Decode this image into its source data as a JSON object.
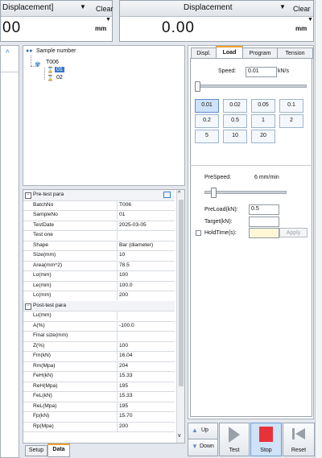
{
  "displays": [
    {
      "title": "Displacement]",
      "clear": "Clear",
      "value": "00",
      "unit": "mm"
    },
    {
      "title": "Displacement",
      "clear": "Clear",
      "value": "0.00",
      "unit": "mm"
    }
  ],
  "tree": {
    "root_label": "Sample number",
    "batch": "T006",
    "items": [
      "01",
      "02"
    ]
  },
  "pretest": {
    "title": "Pre-test para",
    "rows": [
      {
        "k": "BatchNo",
        "v": "T006"
      },
      {
        "k": "SampleNo",
        "v": "01"
      },
      {
        "k": "TestDate",
        "v": "2025-03-05"
      },
      {
        "k": "Test one",
        "v": ""
      },
      {
        "k": "Shape",
        "v": "Bar (diameter)"
      },
      {
        "k": "Size(mm)",
        "v": "10"
      },
      {
        "k": "Area(mm^2)",
        "v": "78.5"
      },
      {
        "k": "Lo(mm)",
        "v": "100"
      },
      {
        "k": "Le(mm)",
        "v": "100.0"
      },
      {
        "k": "Lc(mm)",
        "v": "200"
      }
    ]
  },
  "posttest": {
    "title": "Post-test para",
    "rows": [
      {
        "k": "Lu(mm)",
        "v": ""
      },
      {
        "k": "A(%)",
        "v": "-100.0"
      },
      {
        "k": "Final size(mm)",
        "v": ""
      },
      {
        "k": "Z(%)",
        "v": "100"
      },
      {
        "k": "Fm(kN)",
        "v": "16.04"
      },
      {
        "k": "Rm(Mpa)",
        "v": "204"
      },
      {
        "k": "FeH(kN)",
        "v": "15.33"
      },
      {
        "k": "ReH(Mpa)",
        "v": "195"
      },
      {
        "k": "FeL(kN)",
        "v": "15.33"
      },
      {
        "k": "ReL(Mpa)",
        "v": "195"
      },
      {
        "k": "Fp(kN)",
        "v": "15.70"
      },
      {
        "k": "Rp(Mpa)",
        "v": "200"
      }
    ]
  },
  "left_tabs": {
    "setup": "Setup",
    "data": "Data"
  },
  "control_tabs": [
    "Displ.",
    "Load",
    "Program",
    "Tension"
  ],
  "speed": {
    "label": "Speed:",
    "value": "0.01",
    "unit": "kN/s",
    "buttons": [
      "0.01",
      "0.02",
      "0.05",
      "0.1",
      "0.2",
      "0.5",
      "1",
      "2",
      "5",
      "10",
      "20"
    ],
    "selected": "0.01"
  },
  "prespeed": {
    "label": "PreSpeed:",
    "value": "6 mm/min"
  },
  "preload": {
    "label": "PreLoad(kN):",
    "value": "0.5"
  },
  "target": {
    "label": "Target(kN):",
    "value": ""
  },
  "holdtime": {
    "label": "HoldTime(s):",
    "value": "",
    "apply": "Apply"
  },
  "actions": {
    "up": "Up",
    "down": "Down",
    "test": "Test",
    "stop": "Stop",
    "reset": "Reset"
  },
  "colors": {
    "stop": "#e8323a",
    "accent": "#f0a030",
    "selected_btn": "#cfe2f7"
  }
}
